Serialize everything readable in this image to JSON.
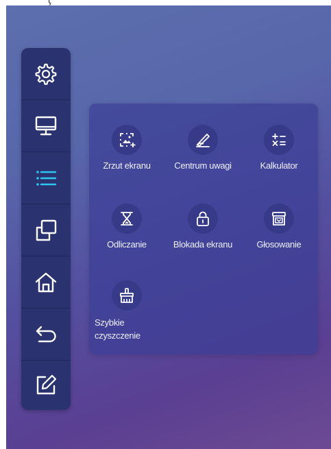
{
  "top_glyph": "ţ",
  "sidebar": {
    "items": [
      {
        "name": "settings",
        "icon": "gear-icon"
      },
      {
        "name": "screen",
        "icon": "monitor-icon"
      },
      {
        "name": "tools",
        "icon": "list-icon",
        "active": true
      },
      {
        "name": "windows",
        "icon": "windows-icon"
      },
      {
        "name": "home",
        "icon": "home-icon"
      },
      {
        "name": "back",
        "icon": "back-icon"
      },
      {
        "name": "annotate",
        "icon": "edit-icon"
      }
    ]
  },
  "panel": {
    "tools": [
      {
        "label": "Zrzut ekranu",
        "icon": "screenshot-icon"
      },
      {
        "label": "Centrum uwagi",
        "icon": "spotlight-icon"
      },
      {
        "label": "Kalkulator",
        "icon": "calculator-icon"
      },
      {
        "label": "Odliczanie",
        "icon": "hourglass-icon"
      },
      {
        "label": "Blokada ekranu",
        "icon": "lock-icon"
      },
      {
        "label": "Głosowanie",
        "icon": "vote-icon"
      },
      {
        "label": "Szybkie czyszczenie",
        "icon": "broom-icon"
      }
    ]
  },
  "colors": {
    "sidebar_bg": "#2a3370",
    "active_icon": "#2ec6f2",
    "icon_white": "#ffffff"
  }
}
